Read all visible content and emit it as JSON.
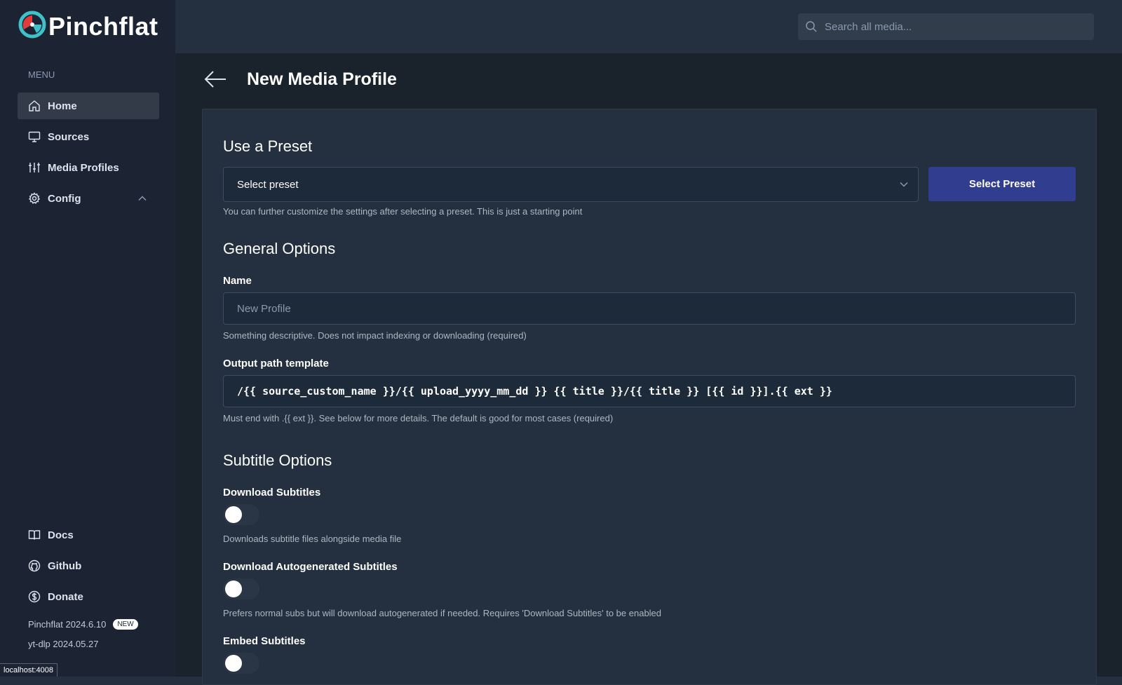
{
  "app": {
    "name": "Pinchflat"
  },
  "header": {
    "search_placeholder": "Search all media..."
  },
  "sidebar": {
    "menu_heading": "MENU",
    "items": [
      {
        "label": "Home",
        "icon": "home-icon",
        "active": true
      },
      {
        "label": "Sources",
        "icon": "monitor-icon"
      },
      {
        "label": "Media Profiles",
        "icon": "sliders-icon"
      },
      {
        "label": "Config",
        "icon": "gear-icon",
        "expanded": true
      }
    ],
    "bottom_items": [
      {
        "label": "Docs",
        "icon": "book-icon"
      },
      {
        "label": "Github",
        "icon": "github-icon"
      },
      {
        "label": "Donate",
        "icon": "dollar-icon"
      }
    ],
    "version": "Pinchflat 2024.6.10",
    "version_badge": "NEW",
    "ytdlp_version": "yt-dlp 2024.05.27"
  },
  "page": {
    "title": "New Media Profile",
    "preset": {
      "section_title": "Use a Preset",
      "select_value": "Select preset",
      "button_label": "Select Preset",
      "help": "You can further customize the settings after selecting a preset. This is just a starting point"
    },
    "general": {
      "section_title": "General Options",
      "name_label": "Name",
      "name_placeholder": "New Profile",
      "name_help": "Something descriptive. Does not impact indexing or downloading (required)",
      "output_label": "Output path template",
      "output_value": "/{{ source_custom_name }}/{{ upload_yyyy_mm_dd }} {{ title }}/{{ title }} [{{ id }}].{{ ext }}",
      "output_help": "Must end with .{{ ext }}. See below for more details. The default is good for most cases (required)"
    },
    "subtitles": {
      "section_title": "Subtitle Options",
      "download_label": "Download Subtitles",
      "download_help": "Downloads subtitle files alongside media file",
      "download_on": false,
      "auto_label": "Download Autogenerated Subtitles",
      "auto_help": "Prefers normal subs but will download autogenerated if needed. Requires 'Download Subtitles' to be enabled",
      "auto_on": false,
      "embed_label": "Embed Subtitles",
      "embed_on": false
    }
  },
  "status_bar": {
    "url": "localhost:4008"
  },
  "colors": {
    "sidebar_bg": "#1c2434",
    "main_bg": "#1a222c",
    "card_bg": "#24303f",
    "primary_button": "#313d8f",
    "logo_teal": "#3fc1c9",
    "logo_red": "#e23b3b"
  }
}
